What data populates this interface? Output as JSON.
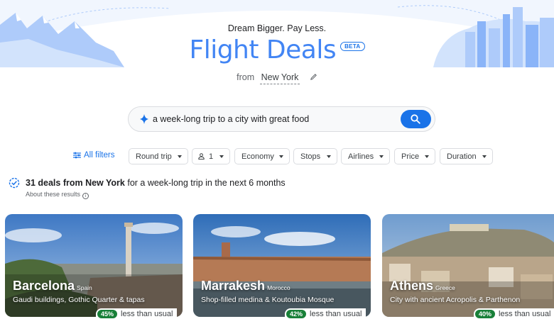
{
  "hero": {
    "tagline": "Dream Bigger. Pay Less.",
    "title": "Flight Deals",
    "badge": "BETA",
    "from_label": "from",
    "from_city": "New York"
  },
  "search": {
    "query": "a week-long trip to a city with great food"
  },
  "filters": {
    "all_filters": "All filters",
    "chips": [
      "Round trip",
      "1",
      "Economy",
      "Stops",
      "Airlines",
      "Price",
      "Duration"
    ]
  },
  "results": {
    "count_text": "31 deals from New York",
    "rest_text": " for a week-long trip in the next 6 months",
    "about": "About these results"
  },
  "cards": [
    {
      "city": "Barcelona",
      "country": "Spain",
      "desc": "Gaudi buildings, Gothic Quarter & tapas",
      "pct": "45%",
      "deal_text": "less than usual"
    },
    {
      "city": "Marrakesh",
      "country": "Morocco",
      "desc": "Shop-filled medina & Koutoubia Mosque",
      "pct": "42%",
      "deal_text": "less than usual"
    },
    {
      "city": "Athens",
      "country": "Greece",
      "desc": "City with ancient Acropolis & Parthenon",
      "pct": "40%",
      "deal_text": "less than usual"
    }
  ],
  "colors": {
    "accent": "#1a73e8",
    "title": "#4285f4",
    "deal_badge": "#188038"
  }
}
